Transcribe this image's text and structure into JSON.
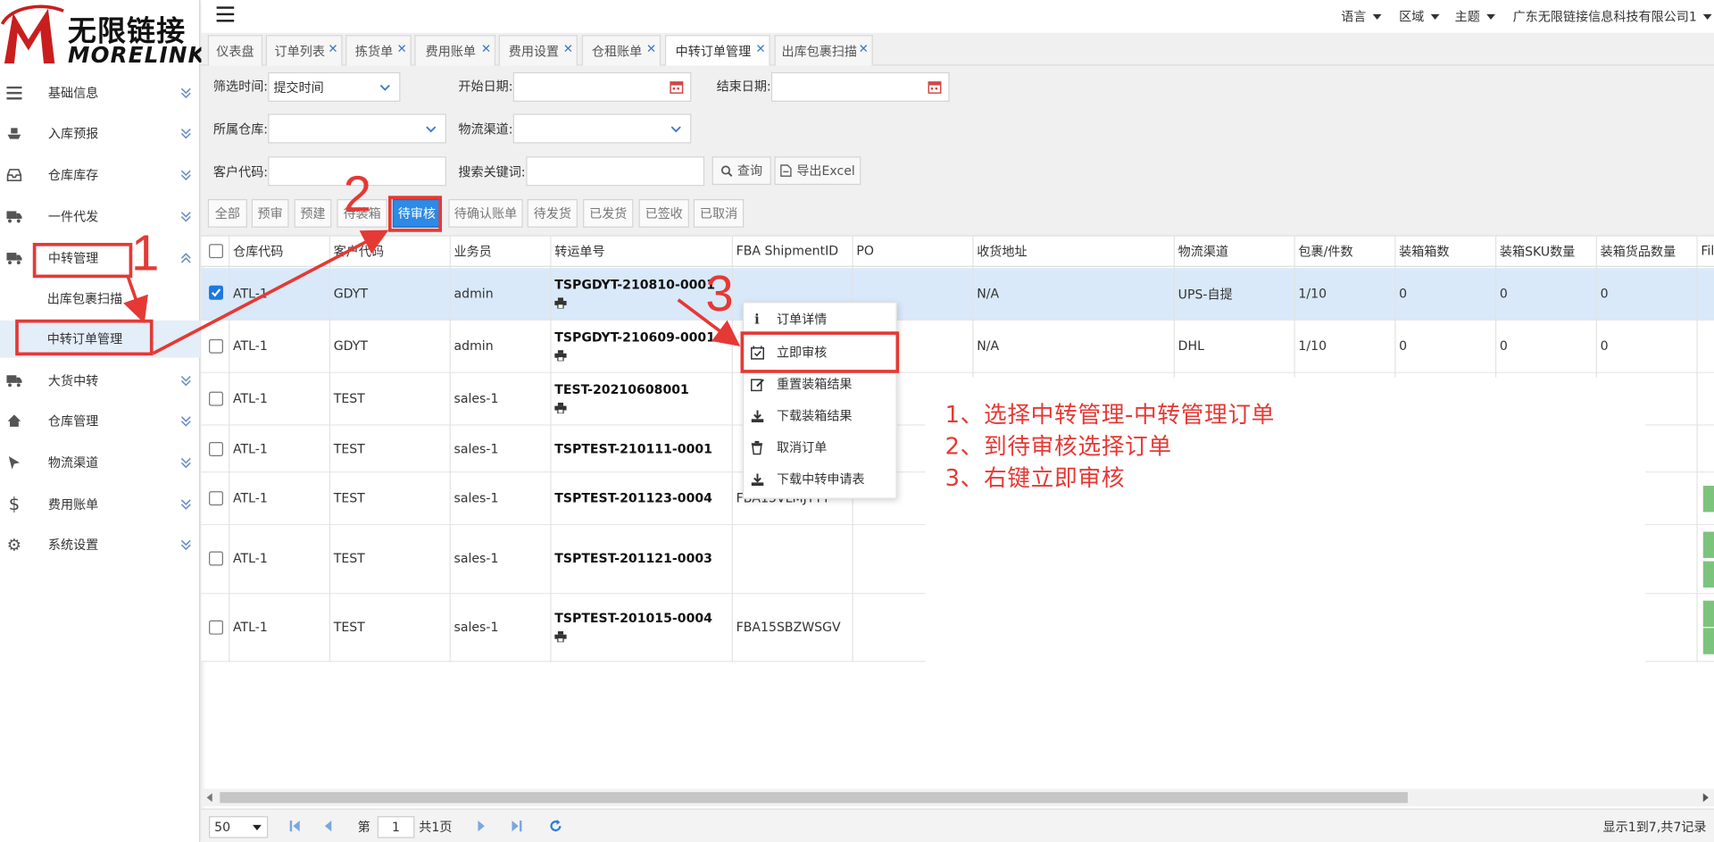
{
  "app": {
    "logo_cn": "无限链接",
    "logo_en": "MORELINK"
  },
  "sidebar": {
    "items": [
      {
        "label": "基础信息",
        "icon": "list-icon"
      },
      {
        "label": "入库预报",
        "icon": "ship-icon"
      },
      {
        "label": "仓库库存",
        "icon": "inbox-icon"
      },
      {
        "label": "一件代发",
        "icon": "truck-icon"
      },
      {
        "label": "中转管理",
        "icon": "truck-icon",
        "expanded": true
      },
      {
        "label": "大货中转",
        "icon": "truck-icon"
      },
      {
        "label": "仓库管理",
        "icon": "home-icon"
      },
      {
        "label": "物流渠道",
        "icon": "cursor-icon"
      },
      {
        "label": "费用账单",
        "icon": "dollar-icon"
      },
      {
        "label": "系统设置",
        "icon": "gear-icon"
      }
    ],
    "sub_items": [
      {
        "label": "出库包裹扫描"
      },
      {
        "label": "中转订单管理",
        "active": true
      }
    ]
  },
  "topbar": {
    "language": "语言",
    "region": "区域",
    "theme": "主题",
    "company": "广东无限链接信息科技有限公司1"
  },
  "tabs": [
    {
      "label": "仪表盘",
      "closable": false
    },
    {
      "label": "订单列表",
      "closable": true
    },
    {
      "label": "拣货单",
      "closable": true
    },
    {
      "label": "费用账单",
      "closable": true
    },
    {
      "label": "费用设置",
      "closable": true
    },
    {
      "label": "仓租账单",
      "closable": true
    },
    {
      "label": "中转订单管理",
      "closable": true,
      "active": true
    },
    {
      "label": "出库包裹扫描",
      "closable": true
    }
  ],
  "filters": {
    "time_filter_label": "筛选时间:",
    "time_filter_value": "提交时间",
    "start_date_label": "开始日期:",
    "end_date_label": "结束日期:",
    "warehouse_label": "所属仓库:",
    "channel_label": "物流渠道:",
    "customer_code_label": "客户代码:",
    "keyword_label": "搜索关键词:",
    "query_button": "查询",
    "export_button": "导出Excel"
  },
  "status_tabs": [
    {
      "label": "全部"
    },
    {
      "label": "预审"
    },
    {
      "label": "预建"
    },
    {
      "label": "待装箱"
    },
    {
      "label": "待审核",
      "active": true
    },
    {
      "label": "待确认账单"
    },
    {
      "label": "待发货"
    },
    {
      "label": "已发货"
    },
    {
      "label": "已签收"
    },
    {
      "label": "已取消"
    }
  ],
  "table": {
    "columns": [
      "仓库代码",
      "客户代码",
      "业务员",
      "转运单号",
      "FBA ShipmentID",
      "PO",
      "收货地址",
      "物流渠道",
      "包裹/件数",
      "装箱箱数",
      "装箱SKU数量",
      "装箱货品数量",
      "Fil"
    ],
    "rows": [
      {
        "warehouse": "ATL-1",
        "customer": "GDYT",
        "sales": "admin",
        "transfer_no": "TSPGDYT-210810-0001",
        "printer": true,
        "fba": "",
        "po": "",
        "address": "N/A",
        "channel": "UPS-自提",
        "parcels": "1/10",
        "boxes": "0",
        "sku_qty": "0",
        "goods_qty": "0",
        "checked": true
      },
      {
        "warehouse": "ATL-1",
        "customer": "GDYT",
        "sales": "admin",
        "transfer_no": "TSPGDYT-210609-0001",
        "printer": true,
        "fba": "",
        "po": "",
        "address": "N/A",
        "channel": "DHL",
        "parcels": "1/10",
        "boxes": "0",
        "sku_qty": "0",
        "goods_qty": "0",
        "checked": false
      },
      {
        "warehouse": "ATL-1",
        "customer": "TEST",
        "sales": "sales-1",
        "transfer_no": "TEST-20210608001",
        "printer": true,
        "fba": "",
        "checked": false
      },
      {
        "warehouse": "ATL-1",
        "customer": "TEST",
        "sales": "sales-1",
        "transfer_no": "TSPTEST-210111-0001",
        "printer": false,
        "fba": "",
        "checked": false
      },
      {
        "warehouse": "ATL-1",
        "customer": "TEST",
        "sales": "sales-1",
        "transfer_no": "TSPTEST-201123-0004",
        "printer": false,
        "fba": "FBA15VLMJYYY",
        "checked": false
      },
      {
        "warehouse": "ATL-1",
        "customer": "TEST",
        "sales": "sales-1",
        "transfer_no": "TSPTEST-201121-0003",
        "printer": false,
        "fba": "",
        "checked": false
      },
      {
        "warehouse": "ATL-1",
        "customer": "TEST",
        "sales": "sales-1",
        "transfer_no": "TSPTEST-201015-0004",
        "printer": true,
        "fba": "FBA15SBZWSGV",
        "checked": false
      }
    ]
  },
  "context_menu": {
    "items": [
      {
        "label": "订单详情",
        "icon": "info-icon"
      },
      {
        "label": "立即审核",
        "icon": "calendar-check-icon"
      },
      {
        "label": "重置装箱结果",
        "icon": "edit-icon"
      },
      {
        "label": "下载装箱结果",
        "icon": "download-icon"
      },
      {
        "label": "取消订单",
        "icon": "trash-icon"
      },
      {
        "label": "下载中转申请表",
        "icon": "download-icon"
      }
    ]
  },
  "annotations": {
    "step1": "1",
    "step2": "2",
    "step3": "3",
    "instructions": [
      "1、选择中转管理-中转管理订单",
      "2、到待审核选择订单",
      "3、右键立即审核"
    ],
    "color": "#e53935"
  },
  "pager": {
    "page_size": "50",
    "page_prefix": "第",
    "page_number": "1",
    "page_total": "共1页",
    "summary": "显示1到7,共7记录"
  },
  "colors": {
    "accent": "#2d8ae6",
    "selected_row": "#d9e9f9",
    "annotation": "#e53935"
  }
}
